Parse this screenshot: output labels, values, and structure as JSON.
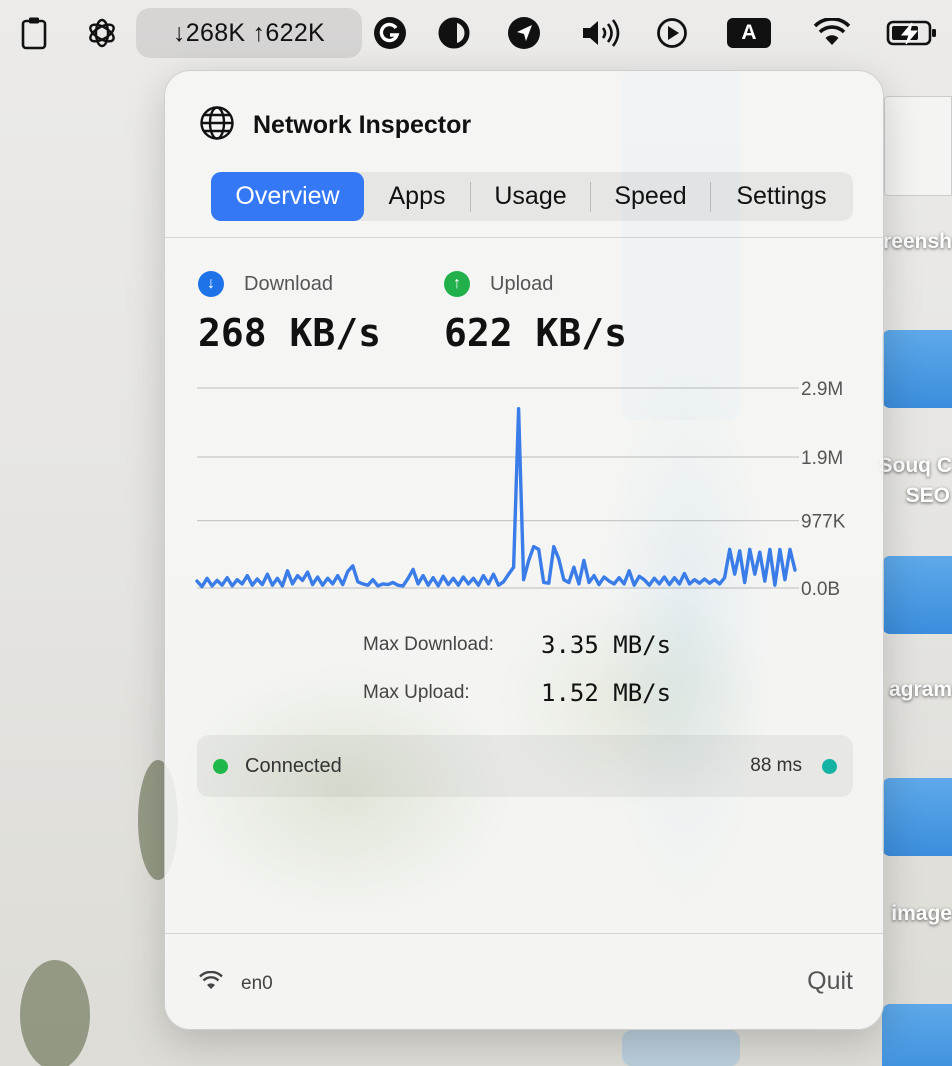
{
  "menubar": {
    "net_pill": "↓268K ↑622K",
    "keyboard_badge": "A",
    "icons": [
      "clipboard-icon",
      "openai-icon",
      "grammarly-icon",
      "contrast-icon",
      "navigation-icon",
      "volume-icon",
      "play-circle-icon",
      "wifi-icon",
      "battery-charging-icon"
    ]
  },
  "desktop": {
    "labels": [
      "reensh",
      "Souq C",
      "SEO",
      "agram",
      "image"
    ]
  },
  "popover": {
    "title": "Network Inspector",
    "title_icon": "globe-icon",
    "tabs": [
      {
        "label": "Overview",
        "active": true
      },
      {
        "label": "Apps",
        "active": false
      },
      {
        "label": "Usage",
        "active": false
      },
      {
        "label": "Speed",
        "active": false
      },
      {
        "label": "Settings",
        "active": false
      }
    ],
    "download": {
      "label": "Download",
      "value": "268 KB/s",
      "color": "#1e73e8"
    },
    "upload": {
      "label": "Upload",
      "value": "622 KB/s",
      "color": "#22b04b"
    },
    "stats": {
      "max_download_label": "Max Download:",
      "max_download_value": "3.35 MB/s",
      "max_upload_label": "Max Upload:",
      "max_upload_value": "1.52 MB/s"
    },
    "status": {
      "text": "Connected",
      "latency": "88 ms",
      "status_color": "#1fb84a",
      "latency_color": "#14b3a4"
    },
    "footer": {
      "interface": "en0",
      "quit_label": "Quit"
    }
  },
  "chart_data": {
    "type": "line",
    "y_tick_labels": [
      "2.9M",
      "1.9M",
      "977K",
      "0.0B"
    ],
    "y_tick_values": [
      2900000,
      1900000,
      977000,
      0
    ],
    "ylim": [
      0,
      2900000
    ],
    "grid": true,
    "series": [
      {
        "color": "#3a7ce8",
        "values": [
          100000,
          20000,
          140000,
          30000,
          110000,
          40000,
          150000,
          30000,
          120000,
          60000,
          180000,
          40000,
          130000,
          50000,
          200000,
          40000,
          140000,
          30000,
          250000,
          60000,
          180000,
          110000,
          230000,
          50000,
          160000,
          40000,
          140000,
          60000,
          180000,
          50000,
          240000,
          320000,
          90000,
          60000,
          40000,
          120000,
          30000,
          60000,
          50000,
          80000,
          40000,
          30000,
          140000,
          270000,
          60000,
          180000,
          40000,
          150000,
          30000,
          170000,
          50000,
          140000,
          40000,
          160000,
          60000,
          140000,
          40000,
          180000,
          60000,
          200000,
          40000,
          90000,
          200000,
          300000,
          2600000,
          120000,
          400000,
          600000,
          560000,
          80000,
          70000,
          600000,
          420000,
          120000,
          80000,
          300000,
          60000,
          400000,
          80000,
          180000,
          50000,
          160000,
          100000,
          60000,
          150000,
          60000,
          250000,
          40000,
          170000,
          120000,
          40000,
          140000,
          60000,
          160000,
          50000,
          150000,
          60000,
          210000,
          60000,
          120000,
          70000,
          130000,
          70000,
          120000,
          60000,
          150000,
          560000,
          200000,
          540000,
          80000,
          560000,
          200000,
          520000,
          100000,
          560000,
          40000,
          560000,
          120000,
          560000,
          260000
        ]
      }
    ]
  }
}
